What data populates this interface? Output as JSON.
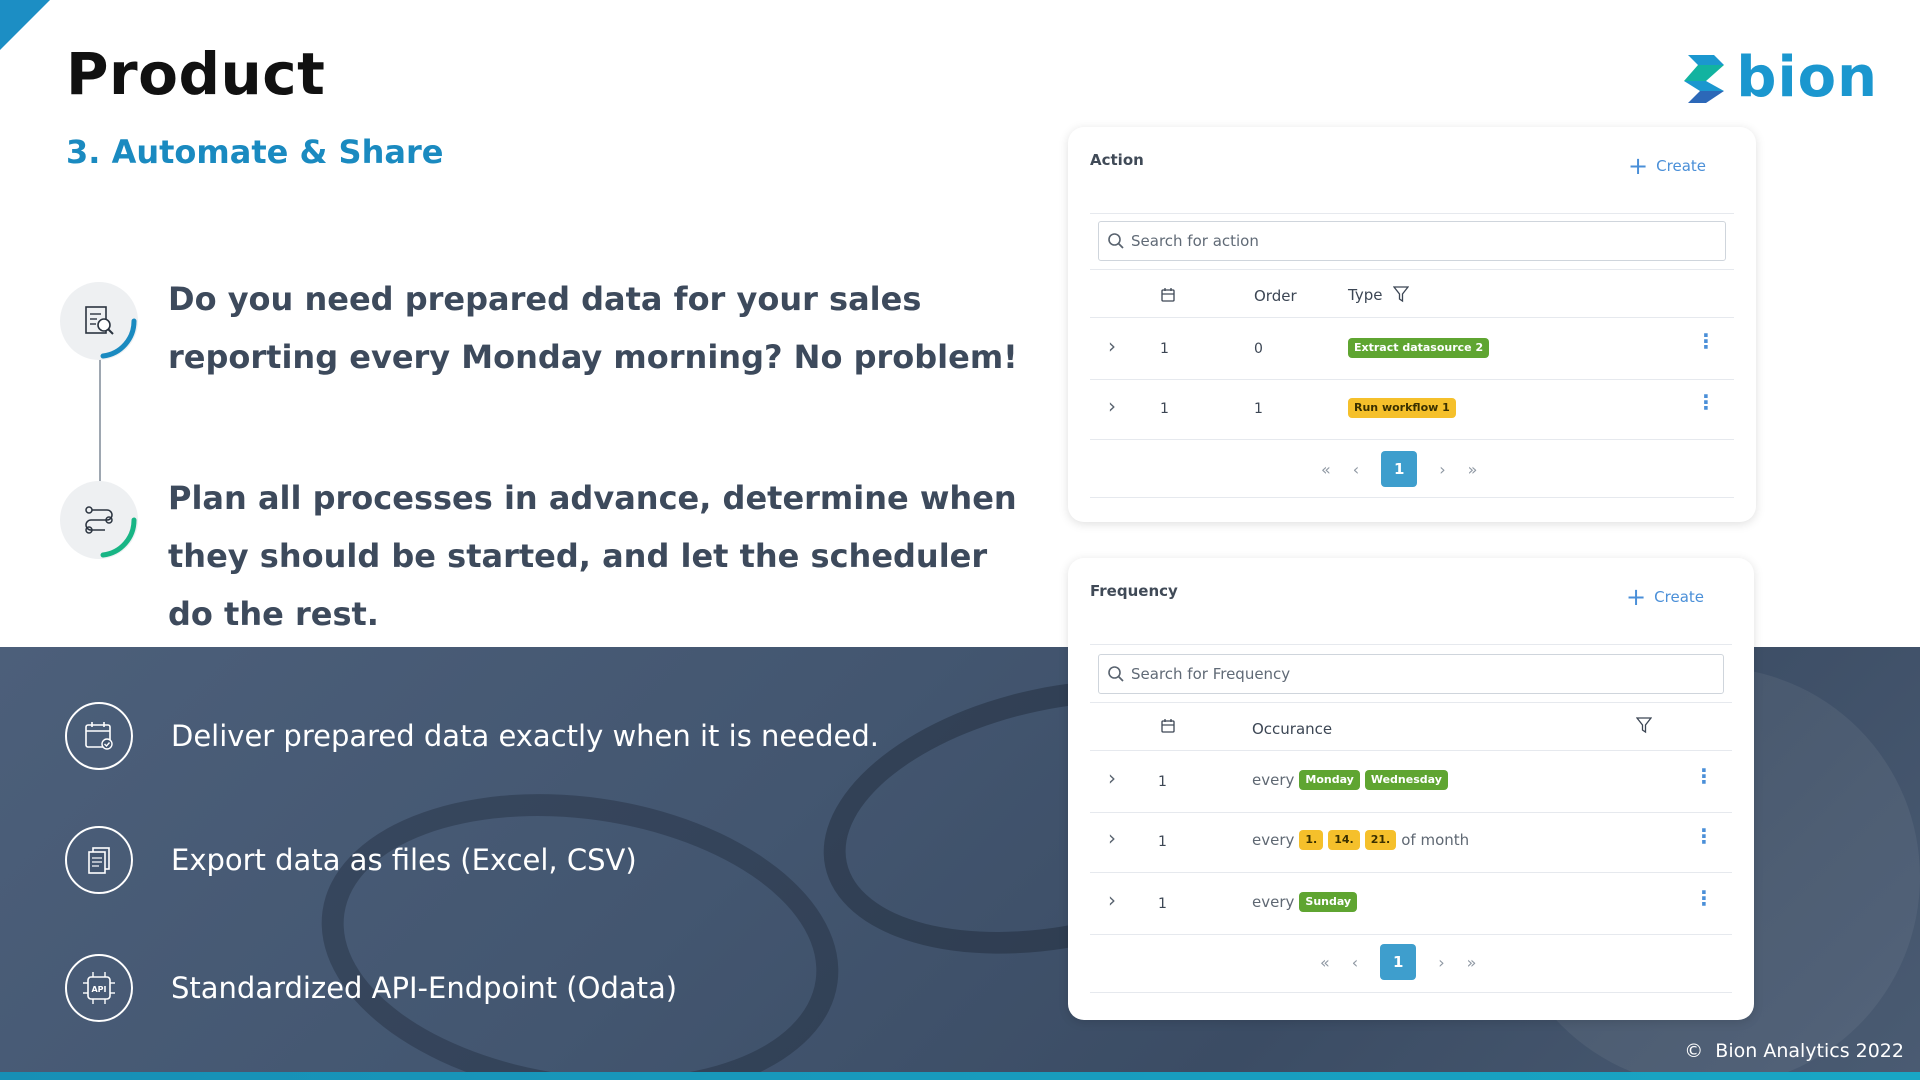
{
  "header": {
    "title": "Product",
    "subtitle": "3. Automate & Share",
    "logo_text": "bion"
  },
  "points": [
    {
      "icon": "report-search-icon",
      "text": "Do you need prepared data for your sales reporting every Monday morning? No problem!"
    },
    {
      "icon": "workflow-icon",
      "text": "Plan all processes in advance, determine when they should be started, and let the scheduler do the rest."
    }
  ],
  "features": [
    {
      "icon": "calendar-check-icon",
      "text": "Deliver prepared data exactly when it is needed."
    },
    {
      "icon": "files-icon",
      "text": "Export data as files (Excel, CSV)"
    },
    {
      "icon": "api-icon",
      "text": "Standardized API-Endpoint (Odata)"
    }
  ],
  "action_panel": {
    "title": "Action",
    "create_label": "Create",
    "search_placeholder": "Search for action",
    "columns": {
      "order": "Order",
      "type": "Type"
    },
    "rows": [
      {
        "id": "1",
        "order": "0",
        "type": "Extract datasource 2",
        "type_color": "#5fa531"
      },
      {
        "id": "1",
        "order": "1",
        "type": "Run workflow 1",
        "type_color": "#f5c02b"
      }
    ],
    "pager": {
      "first": "«",
      "prev": "‹",
      "current": "1",
      "next": "›",
      "last": "»"
    }
  },
  "frequency_panel": {
    "title": "Frequency",
    "create_label": "Create",
    "search_placeholder": "Search for Frequency",
    "columns": {
      "occurance": "Occurance"
    },
    "rows": [
      {
        "id": "1",
        "prefix": "every",
        "tags": [
          "Monday",
          "Wednesday"
        ],
        "tag_color": "green",
        "suffix": ""
      },
      {
        "id": "1",
        "prefix": "every",
        "tags": [
          "1.",
          "14.",
          "21."
        ],
        "tag_color": "yellow",
        "suffix": "of month"
      },
      {
        "id": "1",
        "prefix": "every",
        "tags": [
          "Sunday"
        ],
        "tag_color": "green",
        "suffix": ""
      }
    ],
    "pager": {
      "first": "«",
      "prev": "‹",
      "current": "1",
      "next": "›",
      "last": "»"
    }
  },
  "footer": {
    "copyright_symbol": "©",
    "copyright": "Bion Analytics 2022"
  },
  "colors": {
    "accent": "#1b97cf",
    "dark_band": "#435670",
    "badge_green": "#5fa531",
    "badge_yellow": "#f5c02b",
    "pager_active": "#3e9ecd"
  }
}
